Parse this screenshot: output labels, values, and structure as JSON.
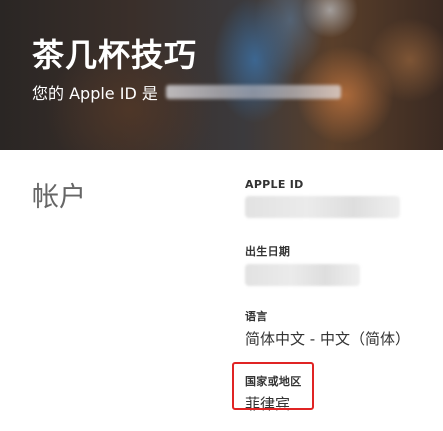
{
  "header": {
    "title": "茶几杯技巧",
    "subtitle_prefix": "您的 Apple ID 是"
  },
  "account": {
    "section_title": "帐户",
    "apple_id_label": "APPLE ID",
    "birth_date_label": "出生日期",
    "language_label": "语言",
    "language_value": "简体中文 - 中文（简体）",
    "country_label": "国家或地区",
    "country_value": "菲律宾"
  },
  "colors": {
    "highlight_border": "#e02424",
    "label_text": "#333333",
    "section_title": "#666666"
  }
}
